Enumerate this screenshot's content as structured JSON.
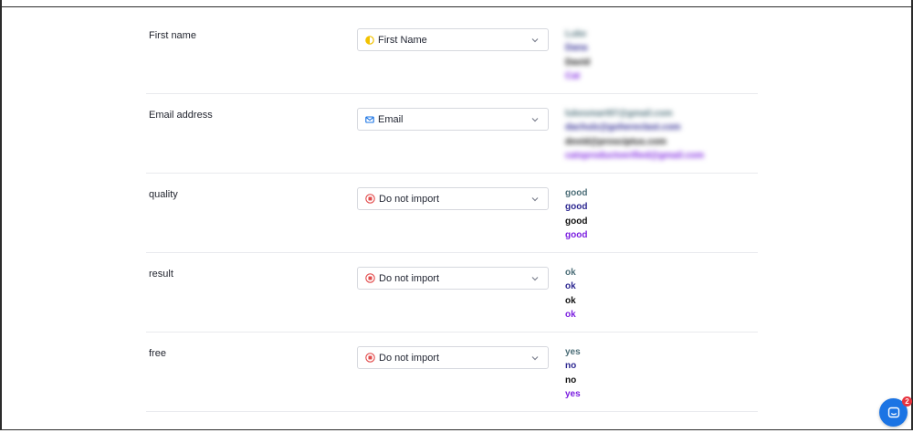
{
  "rows": [
    {
      "label": "First name",
      "mapping": {
        "label": "First Name",
        "icon": "person-half-icon"
      },
      "samples": [
        "Luke",
        "Dana",
        "David",
        "Cat"
      ],
      "blurred": true
    },
    {
      "label": "Email address",
      "mapping": {
        "label": "Email",
        "icon": "envelope-icon"
      },
      "samples": [
        "lukesmart97@gmail.com",
        "dachulz@gohereclast.com",
        "dovid@prosciptus.com",
        "catsproductverified@gmail.com"
      ],
      "blurred": true
    },
    {
      "label": "quality",
      "mapping": {
        "label": "Do not import",
        "icon": "stop-icon"
      },
      "samples": [
        "good",
        "good",
        "good",
        "good"
      ],
      "blurred": false
    },
    {
      "label": "result",
      "mapping": {
        "label": "Do not import",
        "icon": "stop-icon"
      },
      "samples": [
        "ok",
        "ok",
        "ok",
        "ok"
      ],
      "blurred": false
    },
    {
      "label": "free",
      "mapping": {
        "label": "Do not import",
        "icon": "stop-icon"
      },
      "samples": [
        "yes",
        "no",
        "no",
        "yes"
      ],
      "blurred": false
    }
  ],
  "chat": {
    "icon": "chat-icon",
    "badge_count": "2"
  },
  "colors": {
    "sample_1": "#4c6e78",
    "sample_2": "#2d2891",
    "sample_3": "#111111",
    "sample_4": "#7b1fe0",
    "first_name_icon": "#f2c200",
    "email_icon": "#1b74e4",
    "do_not_import_icon": "#e24b4b",
    "chat_button": "#1b74e4",
    "badge": "#e8323d"
  }
}
